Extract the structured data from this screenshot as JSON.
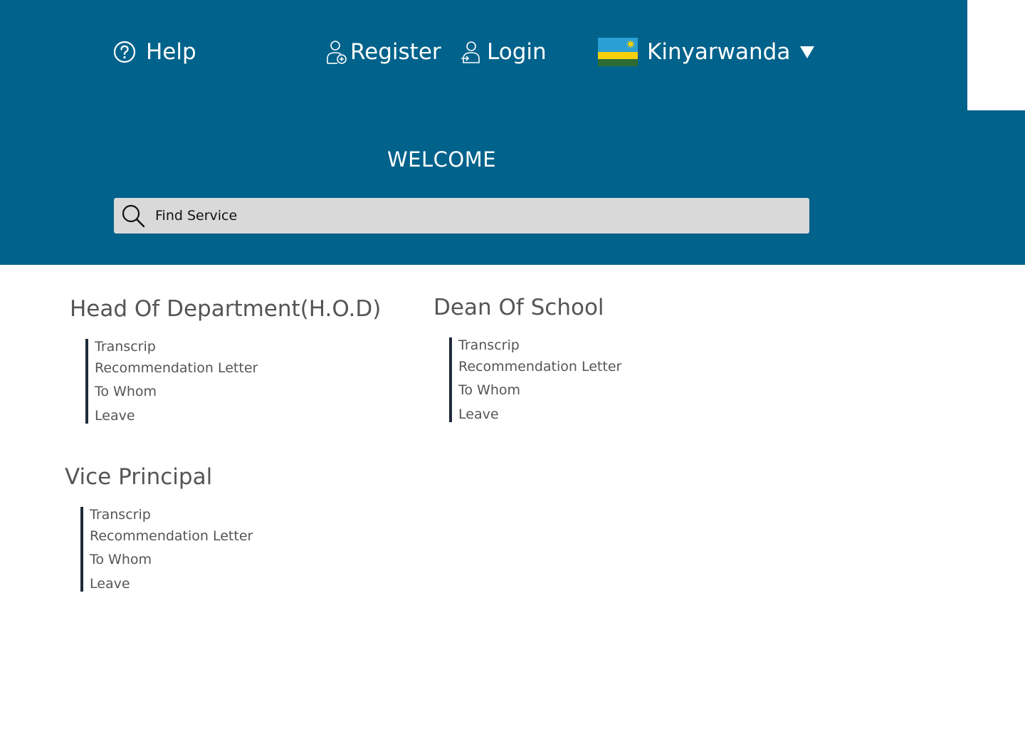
{
  "nav": {
    "help_label": "Help",
    "register_label": "Register",
    "login_label": "Login",
    "language_label": "Kinyarwanda"
  },
  "hero": {
    "title": "WELCOME",
    "search_placeholder": "Find Service"
  },
  "sections": [
    {
      "title": "Head Of Department(H.O.D)",
      "links": [
        "Transcrip",
        "Recommendation Letter",
        "To Whom",
        "Leave"
      ]
    },
    {
      "title": "Dean Of School",
      "links": [
        "Transcrip",
        "Recommendation Letter",
        "To Whom",
        "Leave"
      ]
    },
    {
      "title": "Vice Principal",
      "links": [
        "Transcrip",
        "Recommendation Letter",
        "To Whom",
        "Leave"
      ]
    }
  ],
  "icons": {
    "help": "help-circle-icon",
    "register": "user-add-icon",
    "login": "user-login-icon",
    "language": "rwanda-flag-icon",
    "dropdown": "chevron-down-icon",
    "search": "search-icon"
  },
  "colors": {
    "header_bg": "#01628b",
    "search_bg": "#d9d9d9",
    "text_gray": "#555555",
    "link_bar": "#1f2b3a"
  }
}
